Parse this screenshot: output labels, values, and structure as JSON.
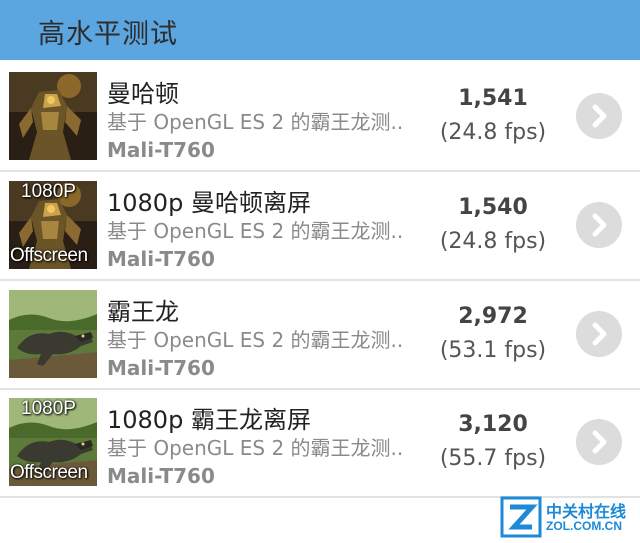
{
  "header": {
    "title": "高水平测试"
  },
  "tests": [
    {
      "name": "曼哈顿",
      "description": "基于 OpenGL ES 2 的霸王龙测..",
      "gpu": "Mali-T760",
      "score": "1,541",
      "fps": "(24.8 fps)",
      "thumb_tag_top": "",
      "thumb_tag_bottom": "",
      "thumb_scene": "robot"
    },
    {
      "name": "1080p 曼哈顿离屏",
      "description": "基于 OpenGL ES 2 的霸王龙测..",
      "gpu": "Mali-T760",
      "score": "1,540",
      "fps": "(24.8 fps)",
      "thumb_tag_top": "1080P",
      "thumb_tag_bottom": "Offscreen",
      "thumb_scene": "robot"
    },
    {
      "name": "霸王龙",
      "description": "基于 OpenGL ES 2 的霸王龙测..",
      "gpu": "Mali-T760",
      "score": "2,972",
      "fps": "(53.1 fps)",
      "thumb_tag_top": "",
      "thumb_tag_bottom": "",
      "thumb_scene": "dinosaur"
    },
    {
      "name": "1080p 霸王龙离屏",
      "description": "基于 OpenGL ES 2 的霸王龙测..",
      "gpu": "Mali-T760",
      "score": "3,120",
      "fps": "(55.7 fps)",
      "thumb_tag_top": "1080P",
      "thumb_tag_bottom": "Offscreen",
      "thumb_scene": "dinosaur"
    }
  ],
  "icons": {
    "row_action": "chevron-right-circle-icon"
  },
  "watermark": {
    "cn": "中关村在线",
    "en": "ZOL.COM.CN"
  },
  "colors": {
    "header_bg": "#5ba5e0",
    "watermark": "#1c8ad6",
    "button_bg": "#dcdcdc"
  }
}
